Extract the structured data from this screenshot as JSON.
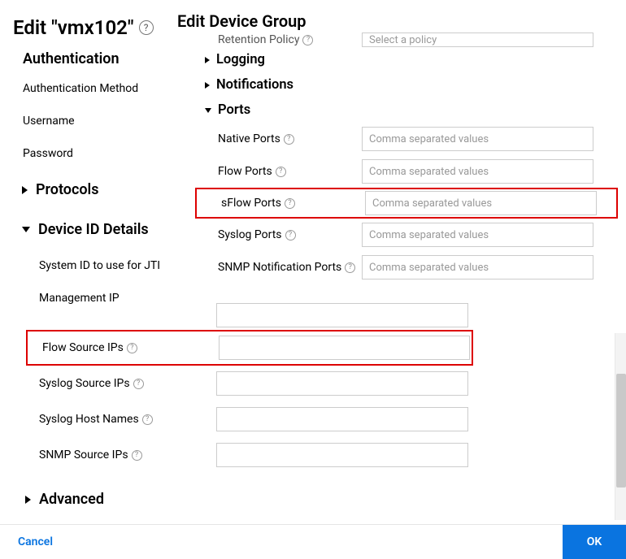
{
  "header": {
    "title_left": "Edit \"vmx102\"",
    "title_right": "Edit Device Group"
  },
  "sidebar": {
    "auth_header": "Authentication",
    "auth_items": [
      "Authentication Method",
      "Username",
      "Password"
    ],
    "protocols_header": "Protocols",
    "device_id_header": "Device ID Details",
    "device_id_items": [
      "System ID to use for JTI",
      "Management IP",
      "Flow Source IPs",
      "Syslog Source IPs",
      "Syslog Host Names",
      "SNMP Source IPs"
    ],
    "advanced_header": "Advanced"
  },
  "right": {
    "retention_label": "Retention Policy",
    "retention_placeholder": "Select a policy",
    "logging_section": "Logging",
    "notifications_section": "Notifications",
    "ports_section": "Ports",
    "port_rows": [
      {
        "label": "Native Ports",
        "placeholder": "Comma separated values"
      },
      {
        "label": "Flow Ports",
        "placeholder": "Comma separated values"
      },
      {
        "label": "sFlow Ports",
        "placeholder": "Comma separated values"
      },
      {
        "label": "Syslog Ports",
        "placeholder": "Comma separated values"
      },
      {
        "label": "SNMP Notification Ports",
        "placeholder": "Comma separated values"
      }
    ]
  },
  "footer": {
    "cancel": "Cancel",
    "ok": "OK"
  }
}
